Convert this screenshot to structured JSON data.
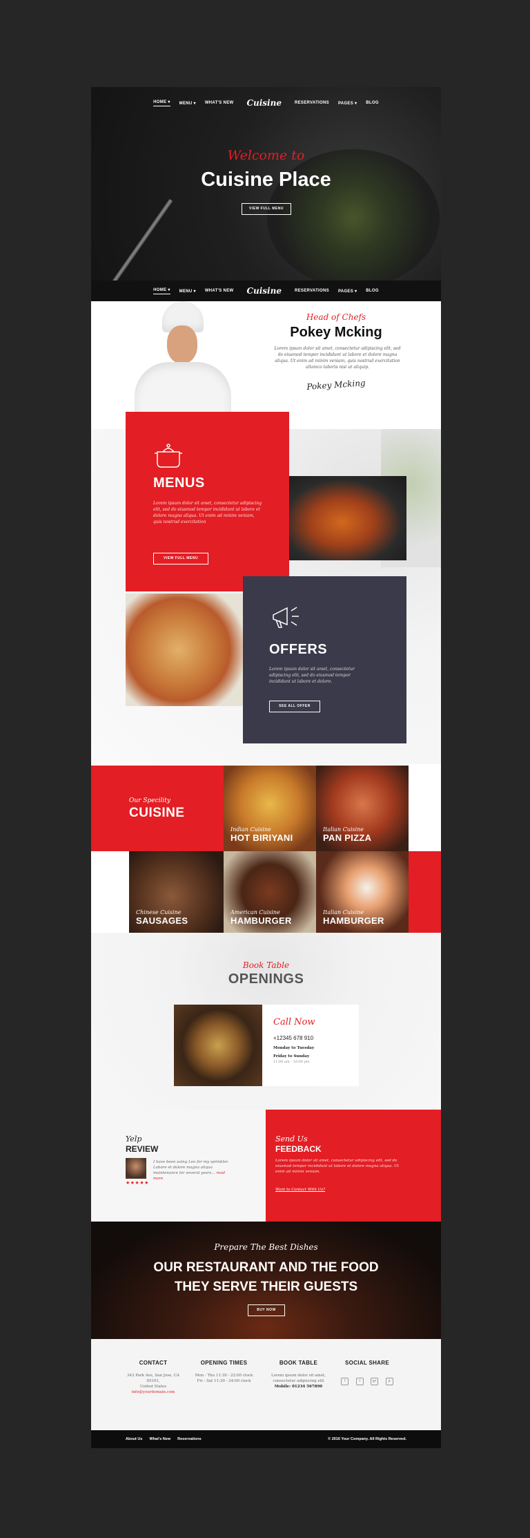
{
  "nav": {
    "items": [
      "HOME ▾",
      "MENU ▾",
      "WHAT'S NEW",
      "RESERVATIONS",
      "PAGES ▾",
      "BLOG"
    ],
    "logo": "Cuisine"
  },
  "hero": {
    "script": "Welcome to",
    "title": "Cuisine Place",
    "button": "VIEW FULL MENU"
  },
  "chef": {
    "script": "Head of Chefs",
    "name": "Pokey Mcking",
    "text": "Lorem ipsum dolor sit amet, consectetur adipiscing elit, sed do eiusmod tempor incididunt ut labore et dolore magna aliqua. Ut enim ad minim veniam, quis nostrud exercitation ullamco laboris nisi ut aliquip.",
    "signature": "Pokey Mcking"
  },
  "menus": {
    "title": "MENUS",
    "text": "Lorem ipsum dolor sit amet, consectetur adipiscing elit, sed do eiusmod tempor incididunt ut labore et dolore magna aliqua. Ut enim ad minim veniam, quis nostrud exercitation",
    "button": "VIEW FULL MENU"
  },
  "offers": {
    "title": "OFFERS",
    "text": "Lorem ipsum dolor sit amet, consectetur adipiscing elit, sed do eiusmod tempor incididunt ut labore et dolore.",
    "button": "SEE ALL OFFER"
  },
  "specialty": {
    "script": "Our Specility",
    "title": "CUISINE",
    "tiles": [
      {
        "sub": "Indian Cuisine",
        "name": "HOT BIRIYANI"
      },
      {
        "sub": "Italian Cuisine",
        "name": "PAN PIZZA"
      },
      {
        "sub": "Chinese Cuisine",
        "name": "SAUSAGES"
      },
      {
        "sub": "American Cuisine",
        "name": "HAMBURGER"
      },
      {
        "sub": "Italian Cuisine",
        "name": "HAMBURGER"
      }
    ]
  },
  "openings": {
    "script": "Book Table",
    "title": "OPENINGS",
    "call": "Call Now",
    "phone": "+12345 678 910",
    "days1": "Monday to Tuesday",
    "days2": "Friday to Sunday",
    "hours": "11:00 am - 10:00 pm"
  },
  "review": {
    "script": "Yelp",
    "title": "REVIEW",
    "text": "I have been using Leo for my sprinkler. Labore et dolore magna aliqua maintenance for several years...",
    "link": "read more",
    "stars": "★★★★★"
  },
  "feedback": {
    "script": "Send Us",
    "title": "FEEDBACK",
    "text": "Lorem ipsum dolor sit amet, consectetur adipiscing elit, sed do eiusmod tempor incididunt ut labore et dolore magna aliqua. Ut enim ad minim veniam.",
    "link": "Want to Contact With Us?"
  },
  "banner": {
    "script": "Prepare The Best Dishes",
    "line1": "OUR RESTAURANT AND THE FOOD",
    "line2": "THEY SERVE THEIR GUESTS",
    "button": "BUY NOW"
  },
  "footer": {
    "contact": {
      "title": "CONTACT",
      "l1": "343 Park Ave, San Jose, CA 95101,",
      "l2": "United States",
      "email": "info@yourdomain.com"
    },
    "hours": {
      "title": "OPENING TIMES",
      "l1": "Mon - Thu 11:30 - 22:00 clock",
      "l2": "Fri - Sat 11:30 - 24:00 clock"
    },
    "book": {
      "title": "BOOK TABLE",
      "l1": "Lorem ipsum dolor sit amet,",
      "l2": "consectetur adipiscing elit",
      "mobile": "Mobile: 01234 567890"
    },
    "social": {
      "title": "SOCIAL SHARE",
      "icons": [
        "f",
        "t",
        "g+",
        "p"
      ]
    }
  },
  "bottom": {
    "links": [
      "About Us",
      "What's New",
      "Reservations"
    ],
    "copyright": "© 2016 Your Company. All Rights Reserved."
  },
  "colors": {
    "accent": "#e31e24",
    "dark": "#3a3a4a",
    "page_bg": "#262626"
  }
}
